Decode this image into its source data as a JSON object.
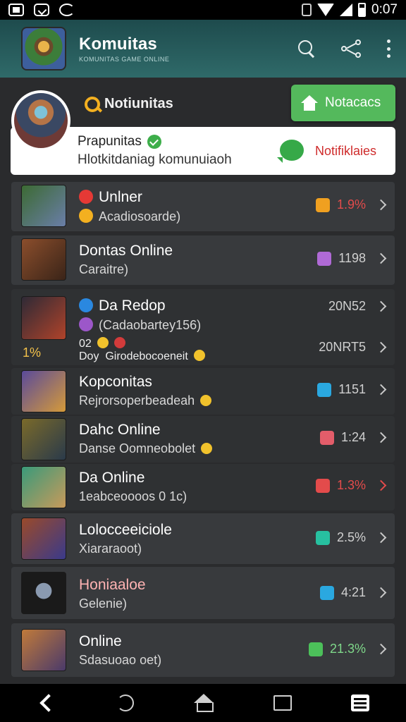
{
  "status_bar": {
    "time": "0:07"
  },
  "app_bar": {
    "title": "Komuitas",
    "subtitle": "KOMUNITAS GAME ONLINE"
  },
  "header": {
    "notif_label": "Notiunitas",
    "notify_button": "Notacacs"
  },
  "profile_card": {
    "name": "Prapunitas",
    "subtitle": "Hlotkitdaniag komunuiaoh",
    "notif_text": "Notifiklaies"
  },
  "list": [
    {
      "title": "Unlner",
      "subtitle": "Acadiosoarde)",
      "value": "1.9%",
      "tag_color": "#f0a020",
      "value_color": "#e34b4b",
      "thumb": "#4a6b3a",
      "badge_color": "#e53935",
      "badge2_color": "#f3b020"
    },
    {
      "title": "Dontas Online",
      "subtitle": "Caraitre)",
      "value": "1198",
      "tag_color": "#b06ad6",
      "value_color": "#d0d0d0",
      "thumb": "#7b4a2c"
    },
    {
      "title": "Da Redop",
      "subtitle": "(Cadaobartey156)",
      "value": "20N52",
      "line2_num": "02",
      "line2_text": "Doy",
      "line2_sub": "Girodebocoeneit",
      "value2": "20NRT5",
      "side_pct": "1%",
      "value_color": "#d0d0d0",
      "thumb": "#3d2f3a",
      "badge_color": "#2a88e0",
      "badge2_color": "#9c57c9"
    },
    {
      "title": "Kopconitas",
      "subtitle": "Rejrorsoperbeadeah",
      "value": "1151",
      "tag_color": "#2aa8e0",
      "value_color": "#d0d0d0",
      "thumb": "#5a4a8a"
    },
    {
      "title": "Dahc Online",
      "subtitle": "Danse Oomneobolet",
      "value": "1:24",
      "tag_color": "#e35d6a",
      "value_color": "#d0d0d0",
      "thumb": "#6b5a2a"
    },
    {
      "title": "Da Online",
      "subtitle": "1eabceoooos 0 1c)",
      "value": "1.3%",
      "tag_color": "#e34b4b",
      "value_color": "#e34b4b",
      "thumb": "#3a7a6a"
    },
    {
      "title": "Lolocceeiciole",
      "subtitle": "Xiararaoot)",
      "value": "2.5%",
      "tag_color": "#27c0a0",
      "value_color": "#d0d0d0",
      "thumb": "#8a4a2a"
    },
    {
      "title": "Honiaaloe",
      "subtitle": "Gelenie)",
      "value": "4:21",
      "tag_color": "#2aa8e0",
      "value_color": "#d0d0d0",
      "thumb": "#2a2f3a",
      "title_color": "#ffb3b3"
    },
    {
      "title": "Online",
      "subtitle": "Sdasuoao oet)",
      "value": "21.3%",
      "tag_color": "#4cc05a",
      "value_color": "#7fd88a",
      "thumb": "#7a4a3a"
    }
  ]
}
